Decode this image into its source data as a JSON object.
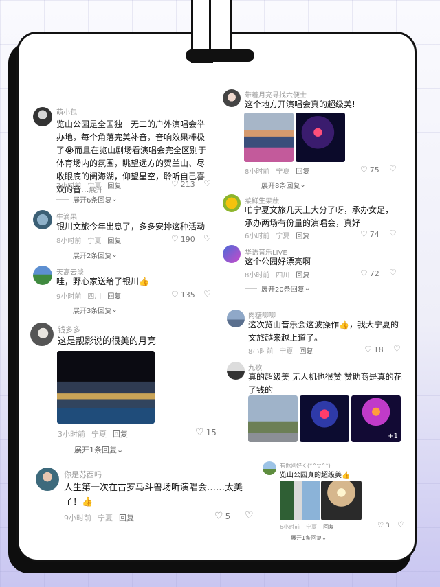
{
  "comments_left": [
    {
      "user": "萌小包",
      "text": "览山公园是全国独一无二的户外演唱会举办地，每个角落完美补音，音响效果棒极了😭而且在览山剧场看演唱会完全区别于体育场内的氛围，眺望远方的贺兰山、尽收眼底的阅海湖，仰望星空，聆听自己喜欢的音...",
      "expand": "展开",
      "time": "7小时前",
      "location": "宁夏",
      "reply": "回复",
      "likes": "213",
      "more": "展开6条回复"
    },
    {
      "user": "牛滴果",
      "text": "银川文旅今年出息了，多多安排这种活动",
      "time": "8小时前",
      "location": "宁夏",
      "reply": "回复",
      "likes": "190",
      "more": "展开2条回复"
    },
    {
      "user": "天高云淡",
      "text": "哇，野心家送给了银川👍",
      "time": "9小时前",
      "location": "四川",
      "reply": "回复",
      "likes": "135",
      "more": "展开3条回复"
    },
    {
      "user": "钱多多",
      "text": "这是靓影说的很美的月亮",
      "time": "3小时前",
      "location": "宁夏",
      "reply": "回复",
      "likes": "15",
      "more": "展开1条回复"
    },
    {
      "user": "你是苏西吗",
      "text": "人生第一次在古罗马斗兽场听演唱会……太美了！👍",
      "time": "9小时前",
      "location": "宁夏",
      "reply": "回复",
      "likes": "5"
    }
  ],
  "comments_right": [
    {
      "user": "带着月亮寻找六便士",
      "text": "这个地方开演唱会真的超级美!",
      "time": "8小时前",
      "location": "宁夏",
      "reply": "回复",
      "likes": "75",
      "more": "展开8条回复"
    },
    {
      "user": "菜鲜生果蔬",
      "text": "咱宁夏文旅几天上大分了呀，承办女足，承办两场有份量的演唱会，真好",
      "time": "6小时前",
      "location": "宁夏",
      "reply": "回复",
      "likes": "74"
    },
    {
      "user": "华语音乐LIVE",
      "text": "这个公园好漂亮啊",
      "time": "8小时前",
      "location": "四川",
      "reply": "回复",
      "likes": "72",
      "more": "展开20条回复"
    },
    {
      "user": "肉糖唧唧",
      "text": "这次览山音乐会这波操作👍，我大宁夏的文旅越来越上道了。",
      "time": "8小时前",
      "location": "宁夏",
      "reply": "回复",
      "likes": "18"
    },
    {
      "user": "九歌",
      "text": "真的超级美  无人机也很赞  赞助商是真的花了钱的",
      "image_count": "+1"
    },
    {
      "user": "有你刚好く(*^▽^*)",
      "text": "览山公园真的超级美👍",
      "time": "6小时前",
      "location": "宁夏",
      "reply": "回复",
      "likes": "3",
      "more": "展开1条回复"
    }
  ],
  "icons": {
    "like": "heart-icon",
    "dislike": "broken-heart-icon",
    "chevron": "chevron-down-icon"
  }
}
